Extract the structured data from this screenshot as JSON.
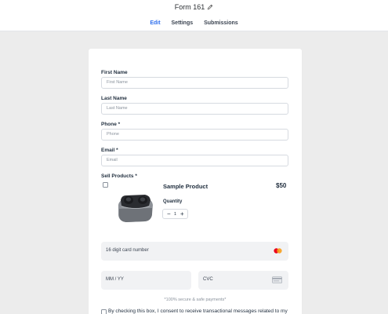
{
  "header": {
    "title": "Form 161",
    "tabs": [
      {
        "label": "Edit",
        "active": true
      },
      {
        "label": "Settings",
        "active": false
      },
      {
        "label": "Submissions",
        "active": false
      }
    ]
  },
  "form": {
    "first_name": {
      "label": "First Name",
      "placeholder": "First Name"
    },
    "last_name": {
      "label": "Last Name",
      "placeholder": "Last Name"
    },
    "phone": {
      "label": "Phone *",
      "placeholder": "Phone"
    },
    "email": {
      "label": "Email *",
      "placeholder": "Email"
    },
    "products": {
      "label": "Sell Products *",
      "item": {
        "name": "Sample Product",
        "price": "$50",
        "quantity_label": "Quantity",
        "quantity": "1",
        "minus": "−",
        "plus": "+"
      }
    },
    "payment": {
      "card_number": "16 digit card number",
      "expiry": "MM / YY",
      "cvc": "CVC",
      "secure_note": "*100% secure & safe payments*"
    },
    "consent": "By checking this box, I consent to receive transactional messages related to my"
  },
  "colors": {
    "accent": "#2f6fed",
    "background": "#ececec",
    "card": "#ffffff"
  }
}
